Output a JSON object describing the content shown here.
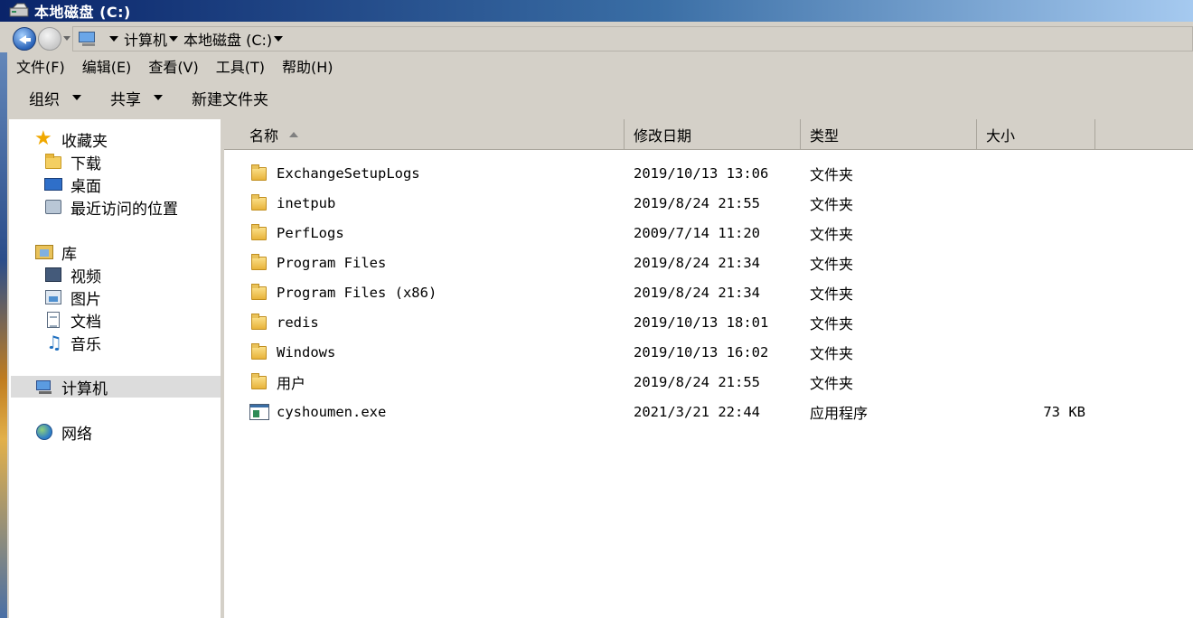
{
  "window": {
    "title": "本地磁盘 (C:)"
  },
  "address": {
    "crumbs": [
      {
        "label": "计算机"
      },
      {
        "label": "本地磁盘 (C:)"
      }
    ]
  },
  "menu": [
    {
      "label": "文件(F)"
    },
    {
      "label": "编辑(E)"
    },
    {
      "label": "查看(V)"
    },
    {
      "label": "工具(T)"
    },
    {
      "label": "帮助(H)"
    }
  ],
  "toolbar": {
    "organize": "组织",
    "share": "共享",
    "new_folder": "新建文件夹"
  },
  "nav": {
    "favorites": {
      "label": "收藏夹",
      "icon": "star-icon",
      "items": [
        {
          "label": "下载",
          "icon": "downloads-folder-icon"
        },
        {
          "label": "桌面",
          "icon": "desktop-icon"
        },
        {
          "label": "最近访问的位置",
          "icon": "recent-places-icon"
        }
      ]
    },
    "libraries": {
      "label": "库",
      "icon": "library-icon",
      "items": [
        {
          "label": "视频",
          "icon": "video-icon"
        },
        {
          "label": "图片",
          "icon": "pictures-icon"
        },
        {
          "label": "文档",
          "icon": "documents-icon"
        },
        {
          "label": "音乐",
          "icon": "music-icon"
        }
      ]
    },
    "computer": {
      "label": "计算机",
      "icon": "computer-icon",
      "selected": true
    },
    "network": {
      "label": "网络",
      "icon": "network-icon"
    }
  },
  "columns": {
    "name": "名称",
    "modified": "修改日期",
    "type": "类型",
    "size": "大小",
    "sort": "name-ascending"
  },
  "files": [
    {
      "name": "ExchangeSetupLogs",
      "modified": "2019/10/13 13:06",
      "type": "文件夹",
      "size": "",
      "icon": "folder-icon"
    },
    {
      "name": "inetpub",
      "modified": "2019/8/24 21:55",
      "type": "文件夹",
      "size": "",
      "icon": "folder-icon"
    },
    {
      "name": "PerfLogs",
      "modified": "2009/7/14 11:20",
      "type": "文件夹",
      "size": "",
      "icon": "folder-icon"
    },
    {
      "name": "Program Files",
      "modified": "2019/8/24 21:34",
      "type": "文件夹",
      "size": "",
      "icon": "folder-icon"
    },
    {
      "name": "Program Files (x86)",
      "modified": "2019/8/24 21:34",
      "type": "文件夹",
      "size": "",
      "icon": "folder-icon"
    },
    {
      "name": "redis",
      "modified": "2019/10/13 18:01",
      "type": "文件夹",
      "size": "",
      "icon": "folder-icon"
    },
    {
      "name": "Windows",
      "modified": "2019/10/13 16:02",
      "type": "文件夹",
      "size": "",
      "icon": "folder-icon"
    },
    {
      "name": "用户",
      "modified": "2019/8/24 21:55",
      "type": "文件夹",
      "size": "",
      "icon": "folder-icon"
    },
    {
      "name": "cyshoumen.exe",
      "modified": "2021/3/21 22:44",
      "type": "应用程序",
      "size": "73 KB",
      "icon": "exe-icon"
    }
  ]
}
